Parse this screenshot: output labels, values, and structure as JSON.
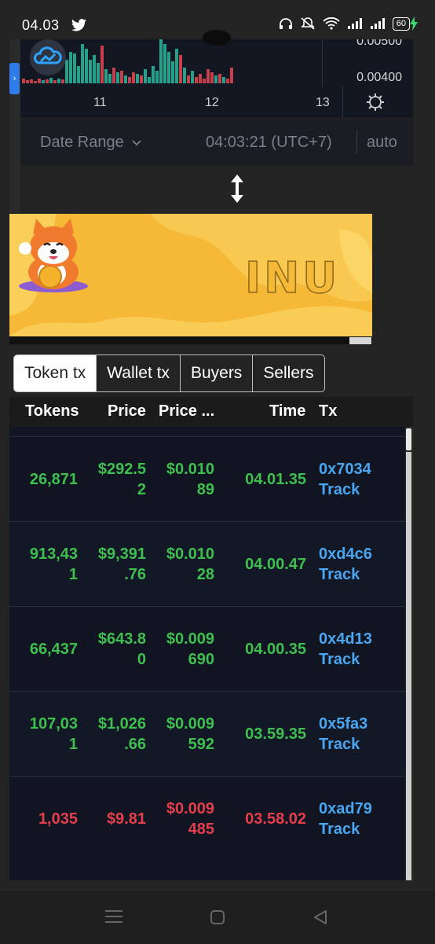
{
  "status_bar": {
    "time": "04.03",
    "battery": "60"
  },
  "chart": {
    "price_labels": [
      "0.00500",
      "0.00400"
    ],
    "x_ticks": [
      "11",
      "12",
      "13"
    ]
  },
  "toolbar": {
    "date_range": "Date Range",
    "clock": "04:03:21 (UTC+7)",
    "auto": "auto"
  },
  "banner": {
    "text": "INU"
  },
  "tabs": [
    "Token tx",
    "Wallet tx",
    "Buyers",
    "Sellers"
  ],
  "table": {
    "headers": [
      "Tokens",
      "Price",
      "Price ...",
      "Time",
      "Tx"
    ],
    "rows": [
      {
        "tokens": [
          "26,871"
        ],
        "price": [
          "$292.5",
          "2"
        ],
        "price_usd": [
          "$0.010",
          "89"
        ],
        "time": "04.01.35",
        "tx": "0x7034",
        "track": "Track",
        "side": "buy"
      },
      {
        "tokens": [
          "913,43",
          "1"
        ],
        "price": [
          "$9,391",
          ".76"
        ],
        "price_usd": [
          "$0.010",
          "28"
        ],
        "time": "04.00.47",
        "tx": "0xd4c6",
        "track": "Track",
        "side": "buy"
      },
      {
        "tokens": [
          "66,437"
        ],
        "price": [
          "$643.8",
          "0"
        ],
        "price_usd": [
          "$0.009",
          "690"
        ],
        "time": "04.00.35",
        "tx": "0x4d13",
        "track": "Track",
        "side": "buy"
      },
      {
        "tokens": [
          "107,03",
          "1"
        ],
        "price": [
          "$1,026",
          ".66"
        ],
        "price_usd": [
          "$0.009",
          "592"
        ],
        "time": "03.59.35",
        "tx": "0x5fa3",
        "track": "Track",
        "side": "buy"
      },
      {
        "tokens": [
          "1,035"
        ],
        "price": [
          "$9.81"
        ],
        "price_usd": [
          "$0.009",
          "485"
        ],
        "time": "03.58.02",
        "tx": "0xad79",
        "track": "Track",
        "side": "sell"
      }
    ]
  },
  "colors": {
    "buy": "#3fbf4f",
    "sell": "#e53e4c",
    "link": "#4aa6f0"
  }
}
